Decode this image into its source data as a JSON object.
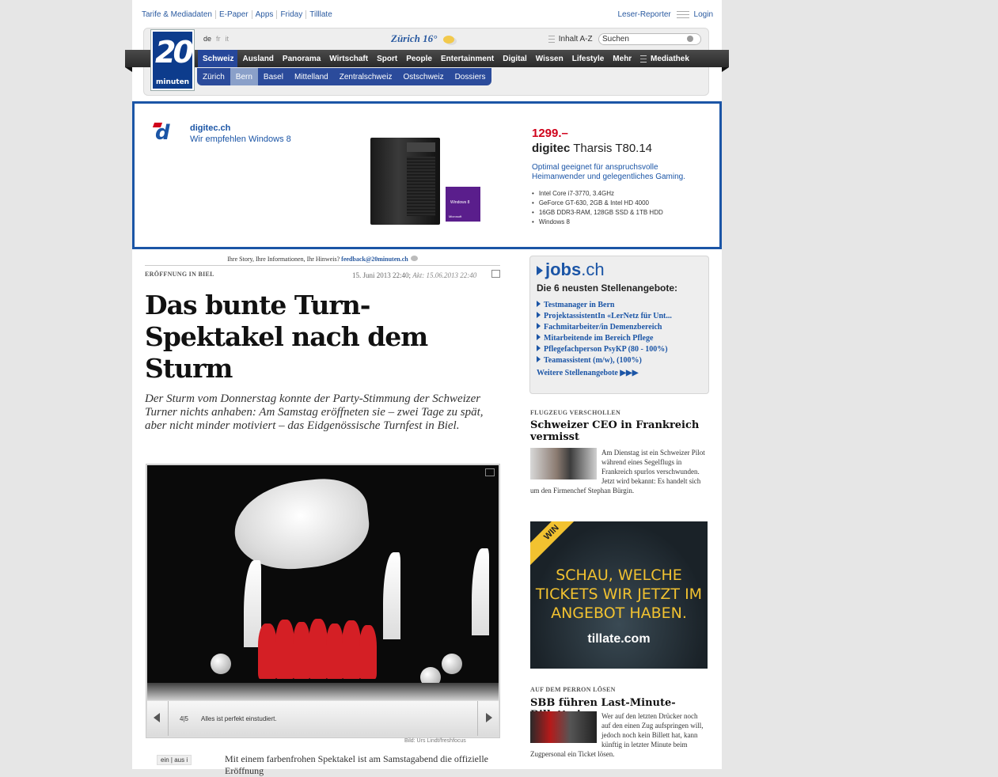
{
  "top_links": [
    "Tarife & Mediadaten",
    "E-Paper",
    "Apps",
    "Friday",
    "Tilllate"
  ],
  "top_right": {
    "reporter": "Leser-Reporter",
    "login": "Login"
  },
  "logo": {
    "number": "20",
    "word": "minuten"
  },
  "languages": {
    "active": "de",
    "others": [
      "fr",
      "it"
    ]
  },
  "weather": {
    "city": "Zürich",
    "temp": "16°",
    "icon": "sun-cloud-icon"
  },
  "inhalt": "Inhalt A-Z",
  "search": {
    "placeholder": "Suchen",
    "value": "Suchen"
  },
  "nav": {
    "items": [
      "Schweiz",
      "Ausland",
      "Panorama",
      "Wirtschaft",
      "Sport",
      "People",
      "Entertainment",
      "Digital",
      "Wissen",
      "Lifestyle",
      "Mehr",
      "Mediathek"
    ],
    "active": "Schweiz"
  },
  "subnav": {
    "items": [
      "Zürich",
      "Bern",
      "Basel",
      "Mittelland",
      "Zentralschweiz",
      "Ostschweiz",
      "Dossiers"
    ],
    "active": "Bern"
  },
  "ad": {
    "brand": "digitec.ch",
    "tagline": "Wir empfehlen Windows 8",
    "price": "1299.–",
    "product_brand": "digitec",
    "product_name": "Tharsis T80.14",
    "description": "Optimal geeignet für anspruchsvolle Heimanwender und gelegentliches Gaming.",
    "specs": [
      "Intel Core i7-3770, 3.4GHz",
      "GeForce GT-630, 2GB & Intel HD 4000",
      "16GB DDR3-RAM, 128GB SSD & 1TB HDD",
      "Windows 8"
    ],
    "win8_label": "Windows 8",
    "win8_maker": "Microsoft"
  },
  "article": {
    "feedback_text": "Ihre Story, Ihre Informationen, Ihr Hinweis?",
    "feedback_email": "feedback@20minuten.ch",
    "kicker": "ERÖFFNUNG IN BIEL",
    "date": "15. Juni 2013 22:40;",
    "updated": "Akt: 15.06.2013 22:40",
    "headline": "Das bunte Turn-Spektakel nach dem Sturm",
    "lead": "Der Sturm vom Donnerstag konnte der Party-Stimmung der Schweizer Turner nichts anhaben: Am Samstag eröffneten sie – zwei Tage zu spät, aber nicht minder motiviert – das Eidgenössische Turnfest in Biel.",
    "slide_count": "4|5",
    "slide_caption": "Alles ist perfekt einstudiert.",
    "credit": "Bild: Urs Lindt/freshfocus",
    "toggle": {
      "on": "ein",
      "off": "aus",
      "info": "i"
    },
    "body_start": "Mit einem farbenfrohen Spektakel ist am Samstagabend die offizielle Eröffnung"
  },
  "jobs": {
    "logo_bold": "jobs",
    "logo_rest": ".ch",
    "title": "Die 6 neusten Stellenangebote:",
    "items": [
      "Testmanager in Bern",
      "ProjektassistentIn «LerNetz für Unt...",
      "Fachmitarbeiter/in Demenzbereich",
      "Mitarbeitende im Bereich Pflege",
      "Pflegefachperson PsyKP (80 - 100%)",
      "Teamassistent (m/w), (100%)"
    ],
    "more": "Weitere Stellenangebote ▶▶▶"
  },
  "teaser1": {
    "kicker": "FLUGZEUG VERSCHOLLEN",
    "headline": "Schweizer CEO in Frankreich vermisst",
    "text": "Am Dienstag ist ein Schweizer Pilot während eines Segelflugs in Frankreich spurlos verschwunden. Jetzt wird bekannt: Es handelt sich um den Firmenchef Stephan Bürgin."
  },
  "winad": {
    "badge": "WIN",
    "text": "SCHAU, WELCHE TICKETS WIR JETZT IM ANGEBOT HABEN.",
    "brand": "tillate.com"
  },
  "teaser2": {
    "kicker": "AUF DEM PERRON LÖSEN",
    "headline": "SBB führen Last-Minute-Billett ein",
    "text": "Wer auf den letzten Drücker noch auf den einen Zug aufspringen will, jedoch noch kein Billett hat, kann künftig in letzter Minute beim Zugpersonal ein Ticket lösen."
  }
}
